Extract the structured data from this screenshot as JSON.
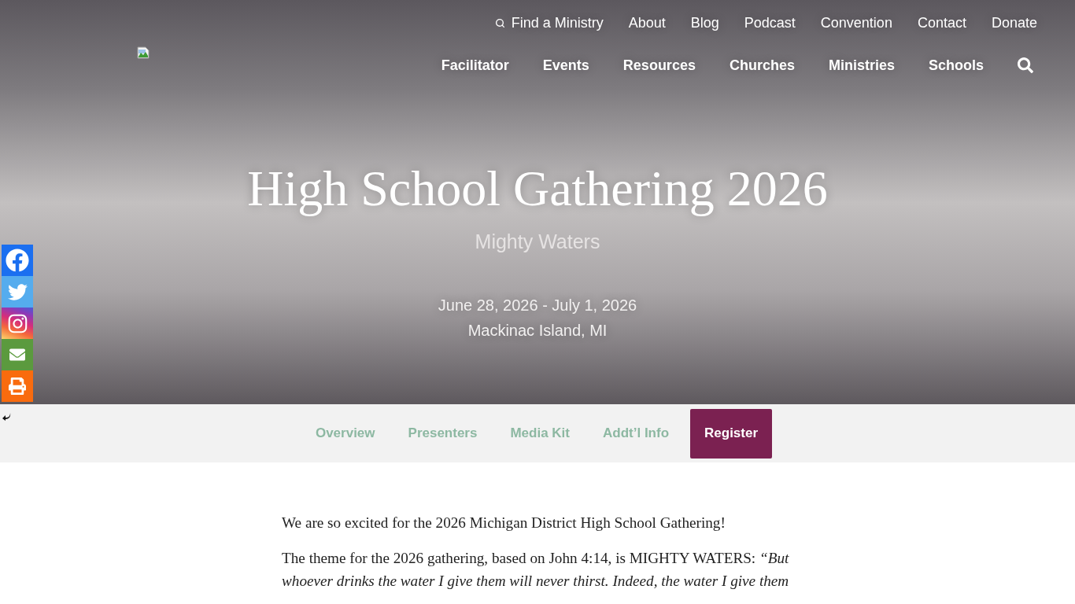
{
  "header": {
    "utility_nav": [
      {
        "label": "Find a Ministry",
        "kind": "search"
      },
      {
        "label": "About",
        "kind": "link"
      },
      {
        "label": "Blog",
        "kind": "link"
      },
      {
        "label": "Podcast",
        "kind": "link"
      },
      {
        "label": "Convention",
        "kind": "link"
      },
      {
        "label": "Contact",
        "kind": "link"
      },
      {
        "label": "Donate",
        "kind": "link"
      }
    ],
    "main_nav": [
      "Facilitator",
      "Events",
      "Resources",
      "Churches",
      "Ministries",
      "Schools"
    ]
  },
  "hero": {
    "title": "High School Gathering 2026",
    "subtitle": "Mighty Waters",
    "dates": "June 28, 2026 - July 1, 2026",
    "location": "Mackinac Island, MI"
  },
  "event_nav": [
    {
      "label": "Overview",
      "kind": "link"
    },
    {
      "label": "Presenters",
      "kind": "link"
    },
    {
      "label": "Media Kit",
      "kind": "link"
    },
    {
      "label": "Addt’l Info",
      "kind": "link"
    },
    {
      "label": "Register",
      "kind": "button"
    }
  ],
  "content": {
    "paragraphs": [
      "We are so excited for the 2026 Michigan District High School Gathering!",
      "The theme for the 2026 gathering, based on John 4:14, is MIGHTY WATERS: *“But whoever drinks the water I give them will never thirst. Indeed, the water I give them*"
    ]
  }
}
